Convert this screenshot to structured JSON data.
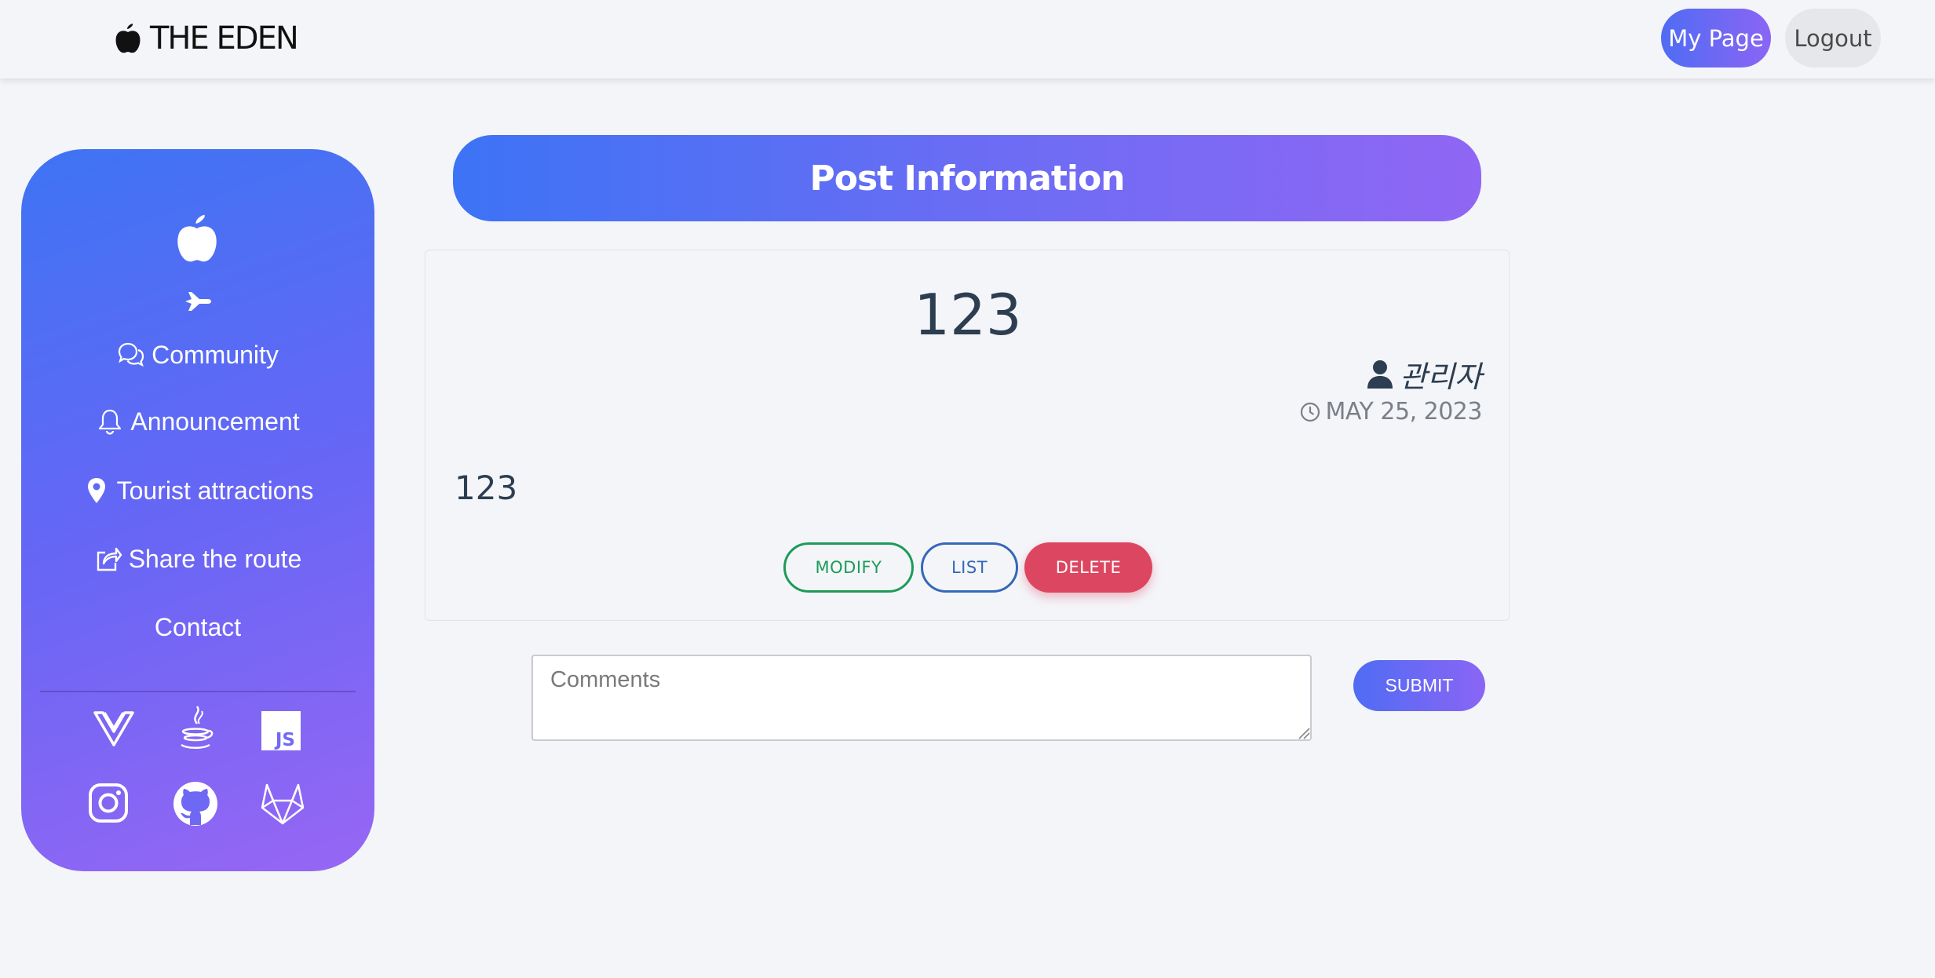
{
  "navbar": {
    "brand_icon": "apple-icon",
    "brand_text": "THE EDEN",
    "mypage_label": "My Page",
    "logout_label": "Logout"
  },
  "sidebar": {
    "logo_icon": "apple-icon",
    "plane_icon": "airplane-icon",
    "items": [
      {
        "icon": "chat-bubbles-icon",
        "label": "Community"
      },
      {
        "icon": "bell-icon",
        "label": "Announcement"
      },
      {
        "icon": "map-pin-icon",
        "label": "Tourist attractions"
      },
      {
        "icon": "share-icon",
        "label": "Share the route"
      },
      {
        "icon": "",
        "label": "Contact"
      }
    ],
    "socials": [
      "vue-icon",
      "java-icon",
      "javascript-icon",
      "instagram-icon",
      "github-icon",
      "gitlab-icon"
    ],
    "js_badge_text": "JS"
  },
  "main": {
    "header_title": "Post Information",
    "post": {
      "title": "123",
      "author": "관리자",
      "date": "MAY 25, 2023",
      "body": "123"
    },
    "buttons": {
      "modify": "MODIFY",
      "list": "LIST",
      "delete": "DELETE"
    },
    "comments": {
      "placeholder": "Comments",
      "value": ""
    },
    "submit_label": "SUBMIT"
  },
  "colors": {
    "accent_start": "#3d73f5",
    "accent_end": "#9066f4",
    "modify": "#1d9b5a",
    "list": "#3568b8",
    "delete": "#dd4660",
    "background": "#f4f5f9"
  }
}
